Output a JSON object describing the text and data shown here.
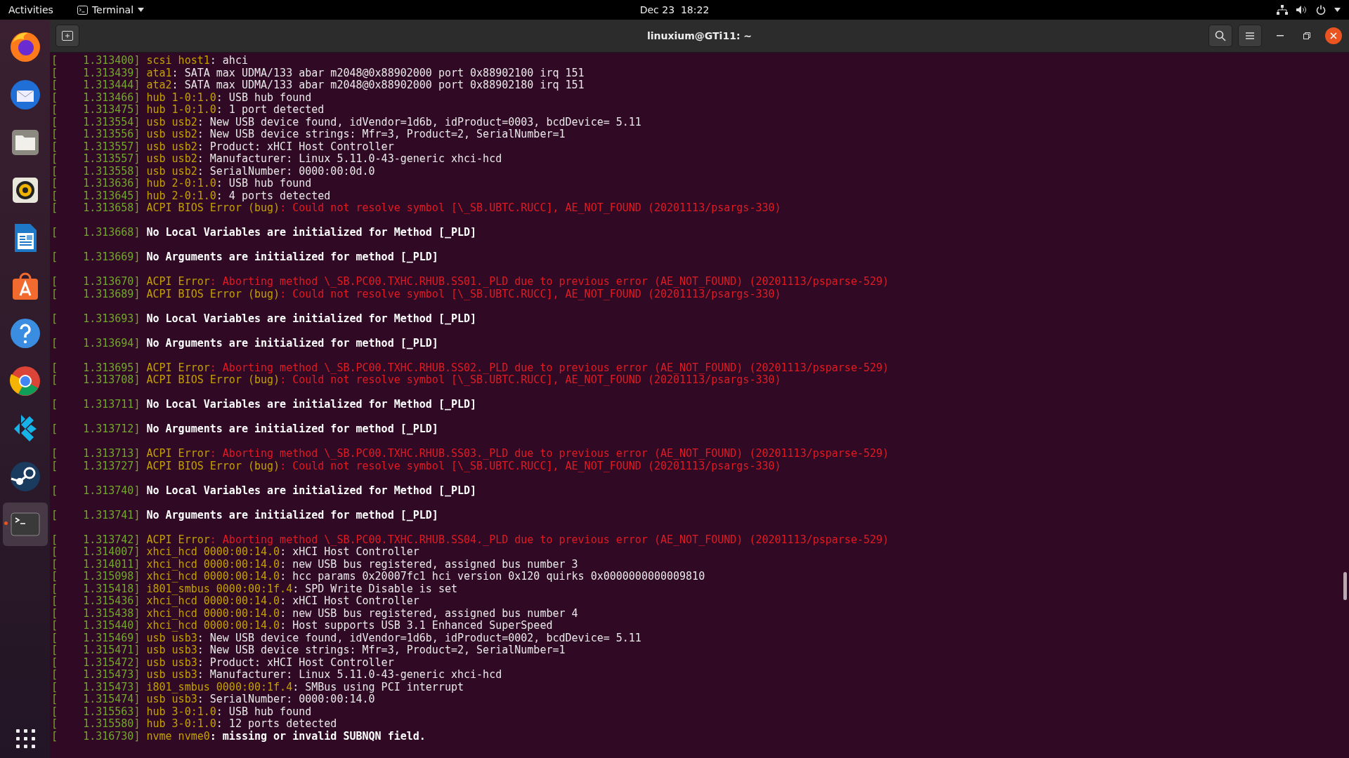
{
  "top_bar": {
    "activities": "Activities",
    "app_menu": "Terminal",
    "clock": "Dec 23  18:22"
  },
  "dock": [
    {
      "kind": "firefox",
      "selected": false
    },
    {
      "kind": "thunderbird",
      "selected": false
    },
    {
      "kind": "files",
      "selected": false
    },
    {
      "kind": "rhythmbox",
      "selected": false
    },
    {
      "kind": "writer",
      "selected": false
    },
    {
      "kind": "software",
      "selected": false
    },
    {
      "kind": "help",
      "selected": false
    },
    {
      "kind": "chrome",
      "selected": false
    },
    {
      "kind": "kodi",
      "selected": false
    },
    {
      "kind": "steam",
      "selected": false
    },
    {
      "kind": "terminal",
      "selected": true
    }
  ],
  "window": {
    "title": "linuxium@GTi11: ~"
  },
  "log": [
    {
      "kind": "info",
      "time": "[    1.313400]",
      "source": "scsi host1",
      "message": ": ahci"
    },
    {
      "kind": "info",
      "time": "[    1.313439]",
      "source": "ata1",
      "message": ": SATA max UDMA/133 abar m2048@0x88902000 port 0x88902100 irq 151"
    },
    {
      "kind": "info",
      "time": "[    1.313444]",
      "source": "ata2",
      "message": ": SATA max UDMA/133 abar m2048@0x88902000 port 0x88902180 irq 151"
    },
    {
      "kind": "info",
      "time": "[    1.313466]",
      "source": "hub 1-0:1.0",
      "message": ": USB hub found"
    },
    {
      "kind": "info",
      "time": "[    1.313475]",
      "source": "hub 1-0:1.0",
      "message": ": 1 port detected"
    },
    {
      "kind": "info",
      "time": "[    1.313554]",
      "source": "usb usb2",
      "message": ": New USB device found, idVendor=1d6b, idProduct=0003, bcdDevice= 5.11"
    },
    {
      "kind": "info",
      "time": "[    1.313556]",
      "source": "usb usb2",
      "message": ": New USB device strings: Mfr=3, Product=2, SerialNumber=1"
    },
    {
      "kind": "info",
      "time": "[    1.313557]",
      "source": "usb usb2",
      "message": ": Product: xHCI Host Controller"
    },
    {
      "kind": "info",
      "time": "[    1.313557]",
      "source": "usb usb2",
      "message": ": Manufacturer: Linux 5.11.0-43-generic xhci-hcd"
    },
    {
      "kind": "info",
      "time": "[    1.313558]",
      "source": "usb usb2",
      "message": ": SerialNumber: 0000:00:0d.0"
    },
    {
      "kind": "info",
      "time": "[    1.313636]",
      "source": "hub 2-0:1.0",
      "message": ": USB hub found"
    },
    {
      "kind": "info",
      "time": "[    1.313645]",
      "source": "hub 2-0:1.0",
      "message": ": 4 ports detected"
    },
    {
      "kind": "error",
      "time": "[    1.313658]",
      "source": "ACPI BIOS Error (bug)",
      "message": ": Could not resolve symbol [\\_SB.UBTC.RUCC], AE_NOT_FOUND (20201113/psargs-330)"
    },
    {
      "kind": "blank"
    },
    {
      "kind": "note",
      "time": "[    1.313668]",
      "message": "No Local Variables are initialized for Method [_PLD]"
    },
    {
      "kind": "blank"
    },
    {
      "kind": "note",
      "time": "[    1.313669]",
      "message": "No Arguments are initialized for method [_PLD]"
    },
    {
      "kind": "blank"
    },
    {
      "kind": "error",
      "time": "[    1.313670]",
      "source": "ACPI Error",
      "message": ": Aborting method \\_SB.PC00.TXHC.RHUB.SS01._PLD due to previous error (AE_NOT_FOUND) (20201113/psparse-529)"
    },
    {
      "kind": "error",
      "time": "[    1.313689]",
      "source": "ACPI BIOS Error (bug)",
      "message": ": Could not resolve symbol [\\_SB.UBTC.RUCC], AE_NOT_FOUND (20201113/psargs-330)"
    },
    {
      "kind": "blank"
    },
    {
      "kind": "note",
      "time": "[    1.313693]",
      "message": "No Local Variables are initialized for Method [_PLD]"
    },
    {
      "kind": "blank"
    },
    {
      "kind": "note",
      "time": "[    1.313694]",
      "message": "No Arguments are initialized for method [_PLD]"
    },
    {
      "kind": "blank"
    },
    {
      "kind": "error",
      "time": "[    1.313695]",
      "source": "ACPI Error",
      "message": ": Aborting method \\_SB.PC00.TXHC.RHUB.SS02._PLD due to previous error (AE_NOT_FOUND) (20201113/psparse-529)"
    },
    {
      "kind": "error",
      "time": "[    1.313708]",
      "source": "ACPI BIOS Error (bug)",
      "message": ": Could not resolve symbol [\\_SB.UBTC.RUCC], AE_NOT_FOUND (20201113/psargs-330)"
    },
    {
      "kind": "blank"
    },
    {
      "kind": "note",
      "time": "[    1.313711]",
      "message": "No Local Variables are initialized for Method [_PLD]"
    },
    {
      "kind": "blank"
    },
    {
      "kind": "note",
      "time": "[    1.313712]",
      "message": "No Arguments are initialized for method [_PLD]"
    },
    {
      "kind": "blank"
    },
    {
      "kind": "error",
      "time": "[    1.313713]",
      "source": "ACPI Error",
      "message": ": Aborting method \\_SB.PC00.TXHC.RHUB.SS03._PLD due to previous error (AE_NOT_FOUND) (20201113/psparse-529)"
    },
    {
      "kind": "error",
      "time": "[    1.313727]",
      "source": "ACPI BIOS Error (bug)",
      "message": ": Could not resolve symbol [\\_SB.UBTC.RUCC], AE_NOT_FOUND (20201113/psargs-330)"
    },
    {
      "kind": "blank"
    },
    {
      "kind": "note",
      "time": "[    1.313740]",
      "message": "No Local Variables are initialized for Method [_PLD]"
    },
    {
      "kind": "blank"
    },
    {
      "kind": "note",
      "time": "[    1.313741]",
      "message": "No Arguments are initialized for method [_PLD]"
    },
    {
      "kind": "blank"
    },
    {
      "kind": "error",
      "time": "[    1.313742]",
      "source": "ACPI Error",
      "message": ": Aborting method \\_SB.PC00.TXHC.RHUB.SS04._PLD due to previous error (AE_NOT_FOUND) (20201113/psparse-529)"
    },
    {
      "kind": "info",
      "time": "[    1.314007]",
      "source": "xhci_hcd 0000:00:14.0",
      "message": ": xHCI Host Controller"
    },
    {
      "kind": "info",
      "time": "[    1.314011]",
      "source": "xhci_hcd 0000:00:14.0",
      "message": ": new USB bus registered, assigned bus number 3"
    },
    {
      "kind": "info",
      "time": "[    1.315098]",
      "source": "xhci_hcd 0000:00:14.0",
      "message": ": hcc params 0x20007fc1 hci version 0x120 quirks 0x0000000000009810"
    },
    {
      "kind": "info",
      "time": "[    1.315418]",
      "source": "i801_smbus 0000:00:1f.4",
      "message": ": SPD Write Disable is set"
    },
    {
      "kind": "info",
      "time": "[    1.315436]",
      "source": "xhci_hcd 0000:00:14.0",
      "message": ": xHCI Host Controller"
    },
    {
      "kind": "info",
      "time": "[    1.315438]",
      "source": "xhci_hcd 0000:00:14.0",
      "message": ": new USB bus registered, assigned bus number 4"
    },
    {
      "kind": "info",
      "time": "[    1.315440]",
      "source": "xhci_hcd 0000:00:14.0",
      "message": ": Host supports USB 3.1 Enhanced SuperSpeed"
    },
    {
      "kind": "info",
      "time": "[    1.315469]",
      "source": "usb usb3",
      "message": ": New USB device found, idVendor=1d6b, idProduct=0002, bcdDevice= 5.11"
    },
    {
      "kind": "info",
      "time": "[    1.315471]",
      "source": "usb usb3",
      "message": ": New USB device strings: Mfr=3, Product=2, SerialNumber=1"
    },
    {
      "kind": "info",
      "time": "[    1.315472]",
      "source": "usb usb3",
      "message": ": Product: xHCI Host Controller"
    },
    {
      "kind": "info",
      "time": "[    1.315473]",
      "source": "usb usb3",
      "message": ": Manufacturer: Linux 5.11.0-43-generic xhci-hcd"
    },
    {
      "kind": "info",
      "time": "[    1.315473]",
      "source": "i801_smbus 0000:00:1f.4",
      "message": ": SMBus using PCI interrupt"
    },
    {
      "kind": "info",
      "time": "[    1.315474]",
      "source": "usb usb3",
      "message": ": SerialNumber: 0000:00:14.0"
    },
    {
      "kind": "info",
      "time": "[    1.315563]",
      "source": "hub 3-0:1.0",
      "message": ": USB hub found"
    },
    {
      "kind": "info",
      "time": "[    1.315580]",
      "source": "hub 3-0:1.0",
      "message": ": 12 ports detected"
    },
    {
      "kind": "warn",
      "time": "[    1.316730]",
      "source": "nvme nvme0",
      "message": ": missing or invalid SUBNQN field."
    }
  ]
}
